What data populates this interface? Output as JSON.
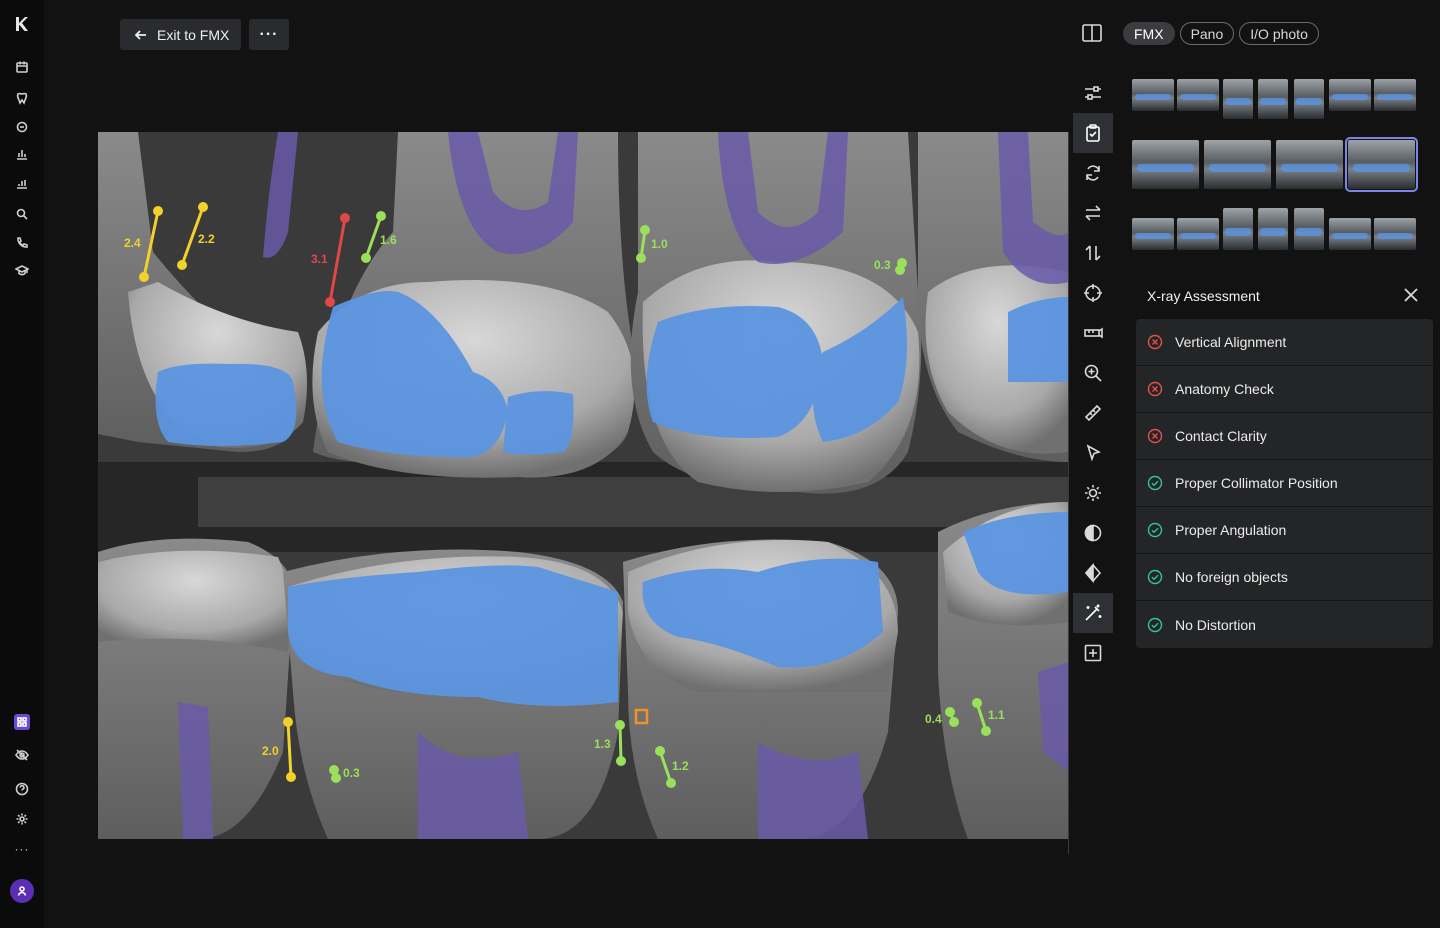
{
  "toolbar": {
    "exit_label": "Exit to FMX",
    "more_label": "···"
  },
  "tabs": [
    {
      "label": "FMX",
      "active": true
    },
    {
      "label": "Pano",
      "active": false
    },
    {
      "label": "I/O photo",
      "active": false
    }
  ],
  "assessment": {
    "title": "X-ray Assessment",
    "items": [
      {
        "label": "Vertical Alignment",
        "status": "fail"
      },
      {
        "label": "Anatomy Check",
        "status": "fail"
      },
      {
        "label": "Contact Clarity",
        "status": "fail"
      },
      {
        "label": "Proper Collimator Position",
        "status": "pass"
      },
      {
        "label": "Proper Angulation",
        "status": "pass"
      },
      {
        "label": "No foreign objects",
        "status": "pass"
      },
      {
        "label": "No Distortion",
        "status": "pass"
      }
    ]
  },
  "measurements": [
    "2.4",
    "2.2",
    "3.1",
    "1.6",
    "1.0",
    "0.3",
    "2.0",
    "0.3",
    "1.3",
    "1.2",
    "0.4",
    "1.1"
  ],
  "colors": {
    "fail": "#e0524a",
    "pass": "#33c29a",
    "restoration": "#5b95e0",
    "pulp": "#6a5aa8",
    "measure_yellow": "#f2d22a",
    "measure_red": "#e04848",
    "measure_green": "#9be05a",
    "active_thumb": "#7c86e6"
  },
  "icons": {
    "rail": [
      "logo-icon",
      "calendar-icon",
      "tooth-chart-icon",
      "tooth-icon",
      "bar-chart-icon",
      "bar-chart-2-icon",
      "search-icon",
      "phone-icon",
      "graduation-cap-icon",
      "apps-icon",
      "eye-off-icon",
      "help-icon",
      "settings-icon",
      "more-icon",
      "user-icon"
    ],
    "tools": [
      "sliders-icon",
      "clipboard-check-icon",
      "refresh-icon",
      "swap-horizontal-icon",
      "swap-vertical-icon",
      "crosshair-icon",
      "ruler-horizontal-icon",
      "zoom-in-icon",
      "ruler-icon",
      "pointer-icon",
      "brightness-icon",
      "contrast-icon",
      "sharpen-icon",
      "magic-wand-icon",
      "add-box-icon"
    ]
  }
}
